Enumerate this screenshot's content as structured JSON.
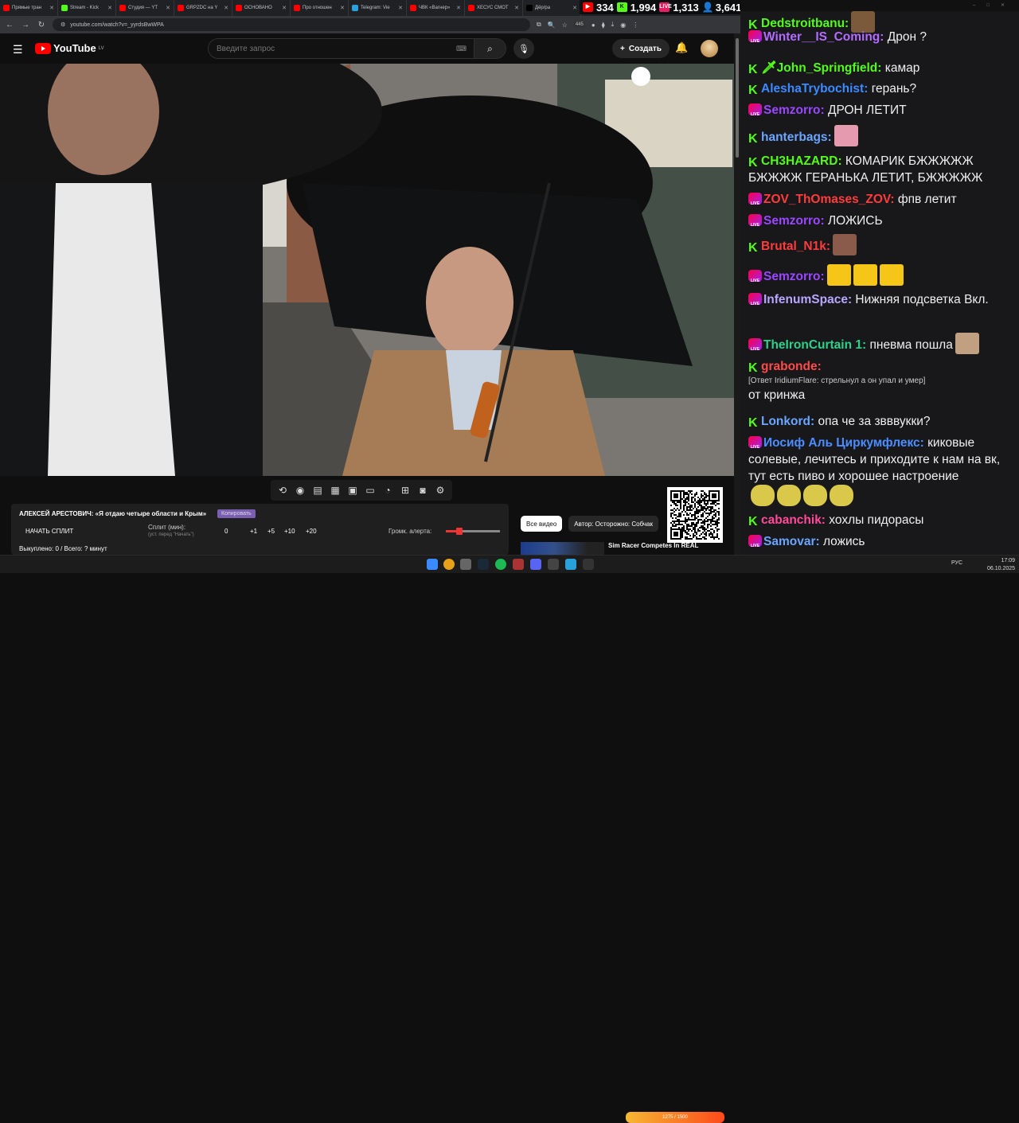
{
  "browser": {
    "tabs": [
      {
        "label": "Прямые тран",
        "color": "#ff0000"
      },
      {
        "label": "Stream - Kick",
        "color": "#53fc18"
      },
      {
        "label": "Студия — YT",
        "color": "#ff0000"
      },
      {
        "label": "GRPZDC на Y",
        "color": "#ff0000"
      },
      {
        "label": "ОСНОВАНО",
        "color": "#ff0000"
      },
      {
        "label": "Про отношен",
        "color": "#ff0000"
      },
      {
        "label": "Telegram: Vie",
        "color": "#2aa1da"
      },
      {
        "label": "ЧВК «Вагнер»",
        "color": "#ff0000"
      },
      {
        "label": "ХЕСУС СМОТ",
        "color": "#ff0000"
      },
      {
        "label": "Дёр/ра",
        "color": "#000000"
      }
    ],
    "url": "youtube.com/watch?v=_yyrdsBwWPA",
    "extension_badge": "445"
  },
  "stream_stats": {
    "youtube_viewers": "334",
    "kick_viewers": "1,994",
    "live_viewers": "1,313",
    "total_viewers": "3,641"
  },
  "youtube": {
    "logo_text": "YouTube",
    "logo_region": "LV",
    "search_placeholder": "Введите запрос",
    "create_label": "Создать",
    "icons": [
      "menu-icon",
      "search-icon",
      "mic-icon",
      "bell-icon",
      "plus-icon"
    ]
  },
  "split_panel": {
    "title": "АЛЕКСЕЙ АРЕСТОВИЧ: «Я отдаю четыре области и Крым»",
    "copy_label": "Копировать",
    "start_label": "НАЧАТЬ СПЛИТ",
    "split_label": "Сплит (мин):",
    "split_hint": "(уст. перед \"Начать\")",
    "split_value": "0",
    "increments": [
      "+1",
      "+5",
      "+10",
      "+20"
    ],
    "volume_label": "Громк. алерта:",
    "volume_level": 0.25,
    "bought_text": "Выкуплено: 0 / Всего: ? минут"
  },
  "chips": [
    "Все видео",
    "Автор: Осторожно: Собчак"
  ],
  "recommendation": {
    "title": "Sim Racer Competes In REAL"
  },
  "ticker": {
    "text": "1275 / 1500"
  },
  "chat": {
    "messages": [
      {
        "badge": "kick",
        "user": "Dedstroitbanu:",
        "color": "#53fc18",
        "text": "",
        "emote": "#7a5a3a"
      },
      {
        "badge": "live",
        "user": "Winter__IS_Coming:",
        "color": "#b46bff",
        "text": "Дрон ?"
      },
      {
        "badge": "kick",
        "user": "🗡John_Springfield:",
        "color": "#53fc18",
        "text": "камар"
      },
      {
        "badge": "kick",
        "user": "AleshaTrybochist:",
        "color": "#3a8bff",
        "text": "герань?"
      },
      {
        "badge": "live",
        "user": "Semzorro:",
        "color": "#9a47ff",
        "text": "ДРОН ЛЕТИТ"
      },
      {
        "badge": "kick",
        "user": "hanterbags:",
        "color": "#6aa6ff",
        "text": "",
        "emote": "#e59ab0"
      },
      {
        "badge": "kick",
        "user": "CH3HAZARD:",
        "color": "#53fc18",
        "text": "КОМАРИК БЖЖЖЖЖ БЖЖЖЖ ГЕРАНЬКА ЛЕТИТ, БЖЖЖЖЖ"
      },
      {
        "badge": "live",
        "user": "ZOV_ThOmases_ZOV:",
        "color": "#ff3b3b",
        "text": "фпв летит"
      },
      {
        "badge": "live",
        "user": "Semzorro:",
        "color": "#9a47ff",
        "text": "ЛОЖИСЬ"
      },
      {
        "badge": "kick",
        "user": "Brutal_N1k:",
        "color": "#ff3b3b",
        "text": "",
        "emote": "#8a5a4a"
      },
      {
        "badge": "live",
        "user": "Semzorro:",
        "color": "#9a47ff",
        "text": "",
        "emote": "#f5c518",
        "emote_count": 3
      },
      {
        "badge": "live",
        "user": "InfenumSpace:",
        "color": "#b9a7ff",
        "text": "Нижняя подсветка Вкл."
      },
      {
        "badge": "live",
        "user": "TheIronCurtain 1:",
        "color": "#2fd08a",
        "text": "пневма пошла",
        "emote_after": "#c0a080"
      },
      {
        "badge": "kick",
        "user": "grabonde:",
        "color": "#ff4a4a",
        "text": "",
        "reply": "[Ответ IridiumFlare: стрельнул а он упал и умер]",
        "after": "от кринжа"
      },
      {
        "badge": "kick",
        "user": "Lonkord:",
        "color": "#6aa6ff",
        "text": "опа че за звввукки?"
      },
      {
        "badge": "live",
        "user": "Иосиф Аль Циркумфлекс:",
        "color": "#4b8dff",
        "text": "киковые солевые, лечитесь и приходите к нам на вк, тут есть пиво и хорошее настроение",
        "emote_row": "#d9c84a",
        "emote_count": 4
      },
      {
        "badge": "kick",
        "user": "cabanchik:",
        "color": "#ff4a9a",
        "text": "хохлы пидорасы"
      },
      {
        "badge": "live",
        "user": "Samovar:",
        "color": "#6aa6ff",
        "text": "ложись"
      }
    ]
  },
  "taskbar": {
    "language": "РУС",
    "time": "17:09",
    "date": "06.10.2025"
  }
}
